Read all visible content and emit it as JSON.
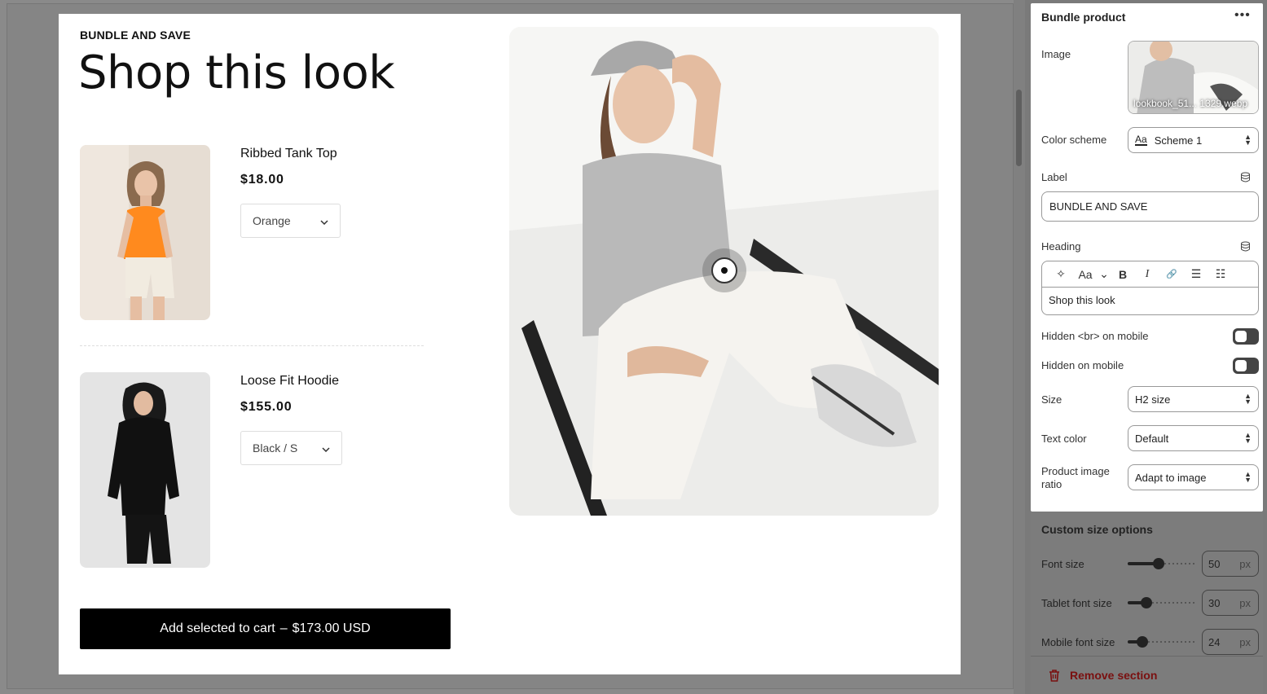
{
  "preview": {
    "label": "BUNDLE AND SAVE",
    "heading": "Shop this look",
    "products": [
      {
        "name": "Ribbed Tank Top",
        "price": "$18.00",
        "variant": "Orange"
      },
      {
        "name": "Loose Fit Hoodie",
        "price": "$155.00",
        "variant": "Black / S"
      }
    ],
    "cart_button": {
      "label": "Add selected to cart",
      "separator": "–",
      "total": "$173.00 USD"
    }
  },
  "panel": {
    "title": "Bundle product",
    "more": "•••",
    "image": {
      "label": "Image",
      "filename": "lookbook_51... 1329.webp"
    },
    "color_scheme": {
      "label": "Color scheme",
      "value": "Scheme 1",
      "icon_text": "Aa"
    },
    "label_field": {
      "label": "Label",
      "value": "BUNDLE AND SAVE"
    },
    "heading_field": {
      "label": "Heading",
      "value": "Shop this look",
      "tools": [
        "✧",
        "Aa",
        "⌄",
        "B",
        "I",
        "🔗",
        "☰",
        "☷"
      ]
    },
    "hidden_br": {
      "label": "Hidden <br> on mobile",
      "on": false
    },
    "hidden_mobile": {
      "label": "Hidden on mobile",
      "on": false
    },
    "size": {
      "label": "Size",
      "value": "H2 size"
    },
    "text_color": {
      "label": "Text color",
      "value": "Default"
    },
    "image_ratio": {
      "label_line1": "Product image",
      "label_line2": "ratio",
      "value": "Adapt to image"
    }
  },
  "custom_size": {
    "title": "Custom size options",
    "font_size": {
      "label": "Font size",
      "value": "50",
      "unit": "px",
      "level": 0.46
    },
    "tablet_font_size": {
      "label": "Tablet font size",
      "value": "30",
      "unit": "px",
      "level": 0.28
    },
    "mobile_font_size": {
      "label": "Mobile font size",
      "value": "24",
      "unit": "px",
      "level": 0.22
    },
    "remove_label": "Remove section"
  },
  "colors": {
    "accent": "#000000",
    "danger": "#7a1010",
    "overlay": "#7a7a7a"
  }
}
